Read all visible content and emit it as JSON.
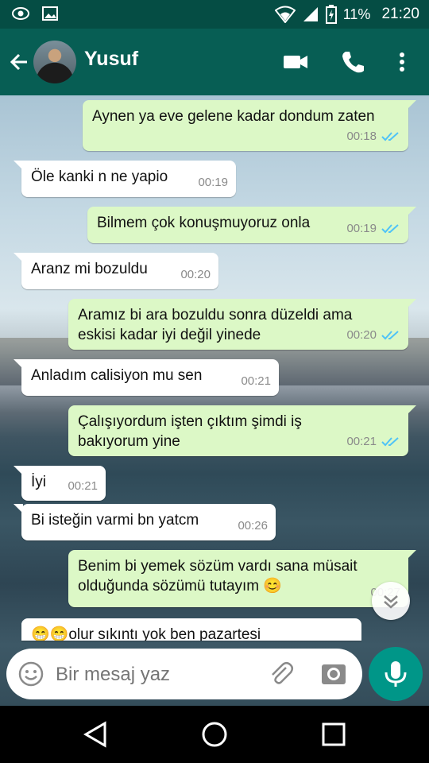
{
  "status_bar": {
    "battery": "11%",
    "time": "21:20"
  },
  "header": {
    "contact_name": "Yusuf",
    "back_icon": "arrow-back-icon",
    "video_icon": "video-call-icon",
    "call_icon": "phone-icon",
    "menu_icon": "more-vert-icon"
  },
  "messages": [
    {
      "side": "out",
      "text": "Aynen ya eve gelene kadar dondum zaten",
      "time": "00:18",
      "read": true
    },
    {
      "side": "in",
      "text": "Öle kanki n ne yapio",
      "time": "00:19"
    },
    {
      "side": "out",
      "text": "Bilmem çok konuşmuyoruz onla",
      "time": "00:19",
      "read": true
    },
    {
      "side": "in",
      "text": "Aranz mi bozuldu",
      "time": "00:20"
    },
    {
      "side": "out",
      "text": "Aramız bi ara bozuldu sonra düzeldi ama eskisi kadar iyi değil yinede",
      "time": "00:20",
      "read": true
    },
    {
      "side": "in",
      "text": "Anladım calisiyon mu sen",
      "time": "00:21"
    },
    {
      "side": "out",
      "text": "Çalışıyordum işten çıktım şimdi iş bakıyorum yine",
      "time": "00:21",
      "read": true
    },
    {
      "side": "in",
      "text": "İyi",
      "time": "00:21"
    },
    {
      "side": "in",
      "text": "Bi isteğin varmi bn yatcm",
      "time": "00:26"
    },
    {
      "side": "out",
      "text": "Benim bi yemek sözüm vardı sana müsait olduğunda sözümü tutayım 😊",
      "time": "00:27"
    },
    {
      "side": "in",
      "text": "😁😁olur sıkıntı yok ben pazartesi"
    }
  ],
  "composer": {
    "placeholder": "Bir mesaj yaz",
    "emoji_icon": "emoji-icon",
    "attach_icon": "paperclip-icon",
    "camera_icon": "camera-icon",
    "mic_icon": "microphone-icon"
  },
  "nav": {
    "back_icon": "nav-back-icon",
    "home_icon": "nav-home-icon",
    "recents_icon": "nav-recents-icon"
  },
  "colors": {
    "header": "#075e54",
    "status_bar": "#054d44",
    "outgoing_bubble": "#dcf8c6",
    "incoming_bubble": "#ffffff",
    "read_ticks": "#4fc3f7",
    "mic_button": "#009688"
  }
}
